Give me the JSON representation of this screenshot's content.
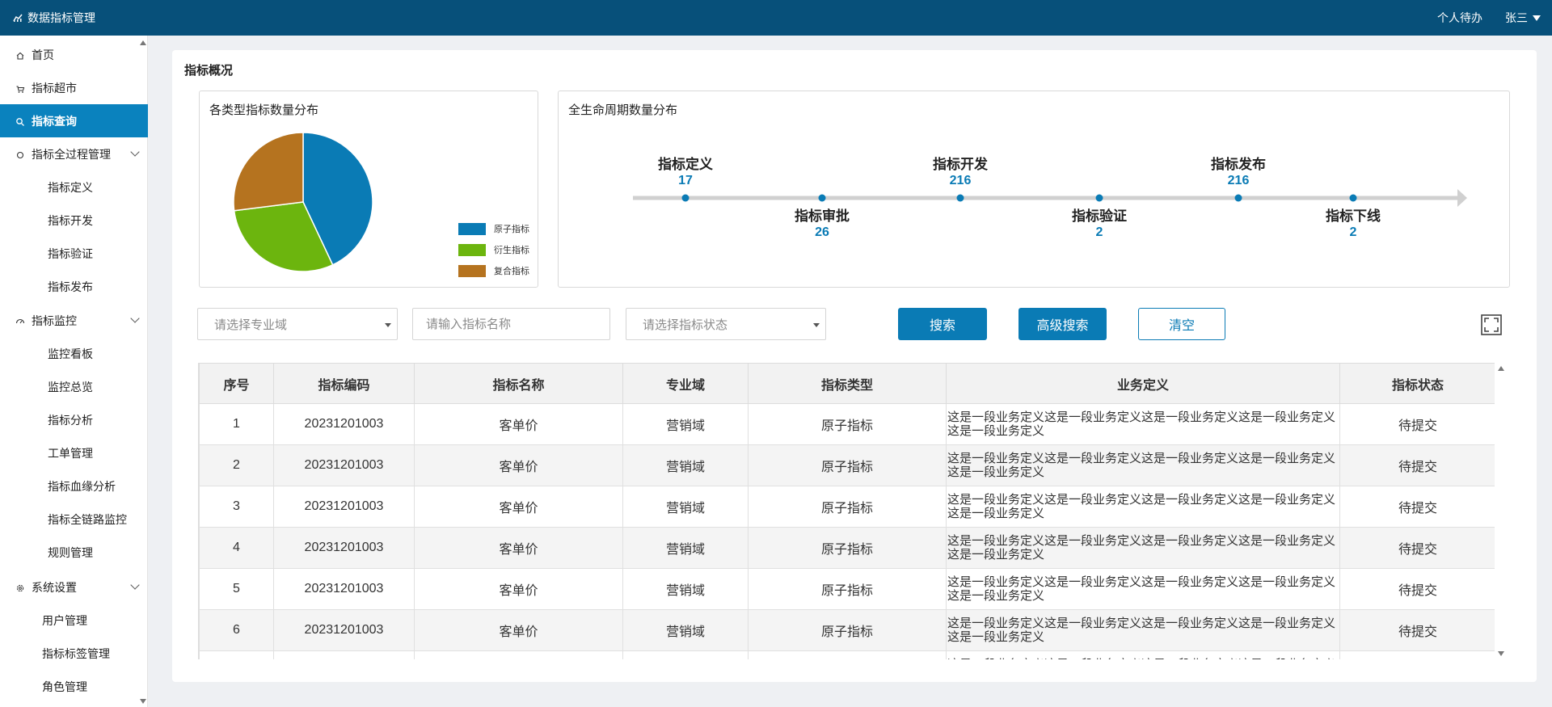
{
  "header": {
    "app_title": "数据指标管理",
    "todo_label": "个人待办",
    "user_name": "张三"
  },
  "sidebar": {
    "items": [
      {
        "label": "首页",
        "icon": "home-icon"
      },
      {
        "label": "指标超市",
        "icon": "cart-icon"
      },
      {
        "label": "指标查询",
        "icon": "search-icon",
        "active": true
      },
      {
        "label": "指标全过程管理",
        "icon": "circle-icon",
        "children": [
          "指标定义",
          "指标开发",
          "指标验证",
          "指标发布"
        ]
      },
      {
        "label": "指标监控",
        "icon": "monitor-icon",
        "children": [
          "监控看板",
          "监控总览",
          "指标分析",
          "工单管理",
          "指标血缘分析",
          "指标全链路监控",
          "规则管理"
        ]
      },
      {
        "label": "系统设置",
        "icon": "gear-icon",
        "children": [
          "用户管理",
          "指标标签管理",
          "角色管理"
        ]
      }
    ]
  },
  "overview": {
    "title": "指标概况",
    "pie_title": "各类型指标数量分布",
    "lifecycle_title": "全生命周期数量分布",
    "lifecycle": [
      {
        "name": "指标定义",
        "value": "17"
      },
      {
        "name": "指标审批",
        "value": "26"
      },
      {
        "name": "指标开发",
        "value": "216"
      },
      {
        "name": "指标验证",
        "value": "2"
      },
      {
        "name": "指标发布",
        "value": "216"
      },
      {
        "name": "指标下线",
        "value": "2"
      }
    ]
  },
  "chart_data": {
    "type": "pie",
    "title": "各类型指标数量分布",
    "legend_position": "bottom-right",
    "categories": [
      "原子指标",
      "衍生指标",
      "复合指标"
    ],
    "values": [
      43,
      30,
      27
    ],
    "colors": [
      "#0a7bb5",
      "#6cb50e",
      "#b5731f"
    ]
  },
  "filters": {
    "domain_placeholder": "请选择专业域",
    "name_placeholder": "请输入指标名称",
    "status_placeholder": "请选择指标状态",
    "search_label": "搜索",
    "advanced_label": "高级搜索",
    "clear_label": "清空"
  },
  "table": {
    "columns": [
      "序号",
      "指标编码",
      "指标名称",
      "专业域",
      "指标类型",
      "业务定义",
      "指标状态"
    ],
    "rows": [
      [
        "1",
        "20231201003",
        "客单价",
        "营销域",
        "原子指标",
        "这是一段业务定义这是一段业务定义这是一段业务定义这是一段业务定义这是一段业务定义",
        "待提交"
      ],
      [
        "2",
        "20231201003",
        "客单价",
        "营销域",
        "原子指标",
        "这是一段业务定义这是一段业务定义这是一段业务定义这是一段业务定义这是一段业务定义",
        "待提交"
      ],
      [
        "3",
        "20231201003",
        "客单价",
        "营销域",
        "原子指标",
        "这是一段业务定义这是一段业务定义这是一段业务定义这是一段业务定义这是一段业务定义",
        "待提交"
      ],
      [
        "4",
        "20231201003",
        "客单价",
        "营销域",
        "原子指标",
        "这是一段业务定义这是一段业务定义这是一段业务定义这是一段业务定义这是一段业务定义",
        "待提交"
      ],
      [
        "5",
        "20231201003",
        "客单价",
        "营销域",
        "原子指标",
        "这是一段业务定义这是一段业务定义这是一段业务定义这是一段业务定义这是一段业务定义",
        "待提交"
      ],
      [
        "6",
        "20231201003",
        "客单价",
        "营销域",
        "原子指标",
        "这是一段业务定义这是一段业务定义这是一段业务定义这是一段业务定义这是一段业务定义",
        "待提交"
      ],
      [
        "",
        "",
        "",
        "",
        "",
        "这是一段业务定义这是一段业务定义这是一段业务定义这是一段业务定义这是一段业务定义",
        ""
      ]
    ]
  }
}
